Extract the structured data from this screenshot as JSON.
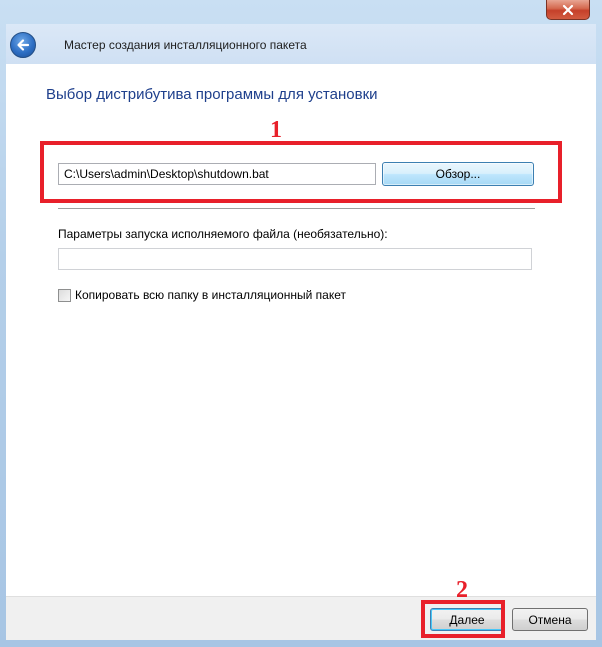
{
  "window": {
    "title": "Мастер создания инсталляционного пакета"
  },
  "page": {
    "heading": "Выбор дистрибутива программы для установки"
  },
  "file": {
    "path_value": "C:\\Users\\admin\\Desktop\\shutdown.bat",
    "browse_label": "Обзор..."
  },
  "params": {
    "label": "Параметры запуска исполняемого файла (необязательно):",
    "value": ""
  },
  "copy_folder": {
    "label": "Копировать всю папку в инсталляционный пакет",
    "checked": false
  },
  "footer": {
    "next_label": "Далее",
    "cancel_label": "Отмена"
  },
  "annotations": {
    "marker_1": "1",
    "marker_2": "2",
    "color": "#e8202a"
  },
  "icons": {
    "close": "close-icon",
    "back": "back-arrow-icon"
  }
}
